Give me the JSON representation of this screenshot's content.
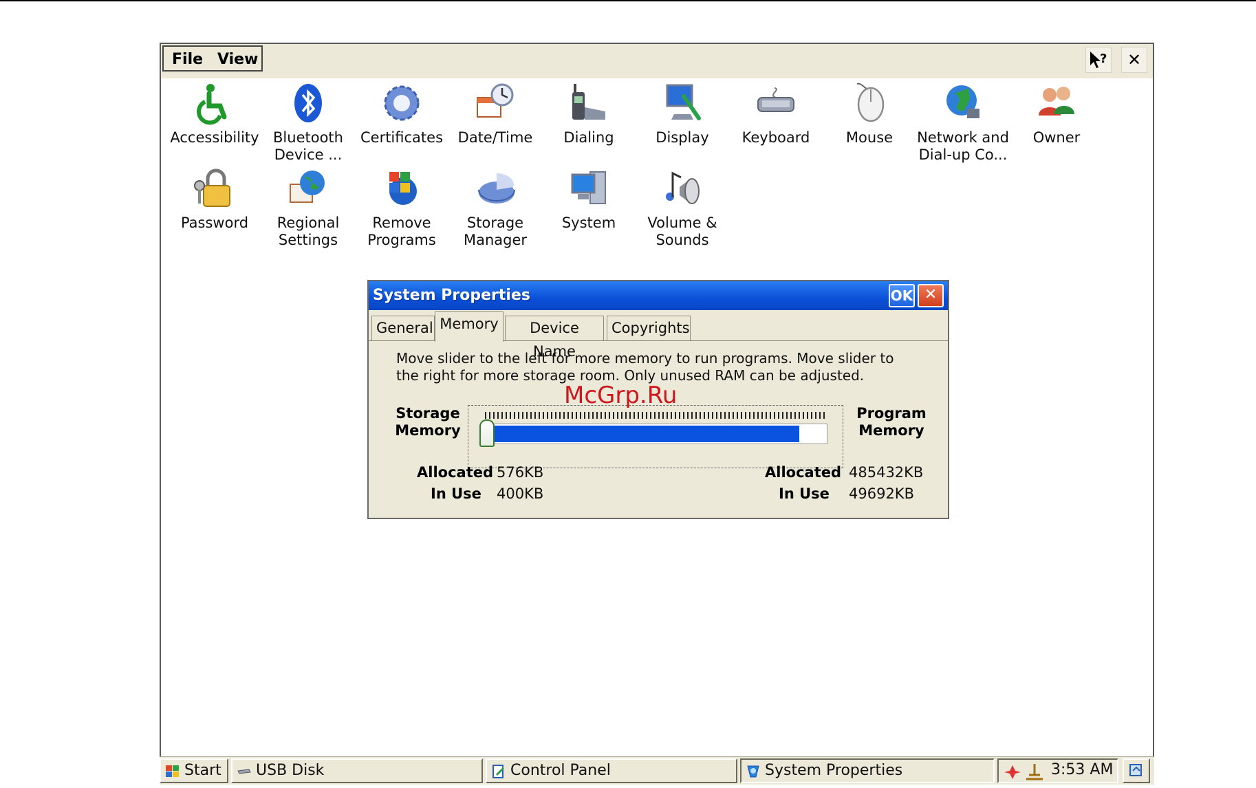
{
  "window": {
    "menu": {
      "file": "File",
      "view": "View"
    },
    "help_label": "?",
    "close_label": "✕"
  },
  "icons": [
    {
      "name": "accessibility",
      "label": "Accessibility"
    },
    {
      "name": "bluetooth",
      "label": "Bluetooth Device ..."
    },
    {
      "name": "certificates",
      "label": "Certificates"
    },
    {
      "name": "datetime",
      "label": "Date/Time"
    },
    {
      "name": "dialing",
      "label": "Dialing"
    },
    {
      "name": "display",
      "label": "Display"
    },
    {
      "name": "keyboard",
      "label": "Keyboard"
    },
    {
      "name": "mouse",
      "label": "Mouse"
    },
    {
      "name": "network",
      "label": "Network and Dial-up Co..."
    },
    {
      "name": "owner",
      "label": "Owner"
    },
    {
      "name": "password",
      "label": "Password"
    },
    {
      "name": "regional",
      "label": "Regional Settings"
    },
    {
      "name": "remove-programs",
      "label": "Remove Programs"
    },
    {
      "name": "storage-manager",
      "label": "Storage Manager"
    },
    {
      "name": "system",
      "label": "System"
    },
    {
      "name": "volume",
      "label": "Volume & Sounds"
    }
  ],
  "dialog": {
    "title": "System Properties",
    "ok_label": "OK",
    "close_label": "✕",
    "tabs": [
      "General",
      "Memory",
      "Device Name",
      "Copyrights"
    ],
    "active_tab": "Memory",
    "description": "Move slider to the left for more memory to run programs. Move slider to the right for more storage room. Only unused RAM can be adjusted.",
    "storage_label_1": "Storage",
    "storage_label_2": "Memory",
    "program_label_1": "Program",
    "program_label_2": "Memory",
    "watermark": "McGrp.Ru",
    "slider_fill_fraction": 0.92,
    "storage": {
      "allocated_label": "Allocated",
      "allocated": "576KB",
      "inuse_label": "In Use",
      "inuse": "400KB"
    },
    "program": {
      "allocated_label": "Allocated",
      "allocated": "485432KB",
      "inuse_label": "In Use",
      "inuse": "49692KB"
    }
  },
  "taskbar": {
    "start": "Start",
    "items": [
      "USB Disk",
      "Control Panel",
      "System Properties"
    ],
    "clock": "3:53 AM"
  }
}
